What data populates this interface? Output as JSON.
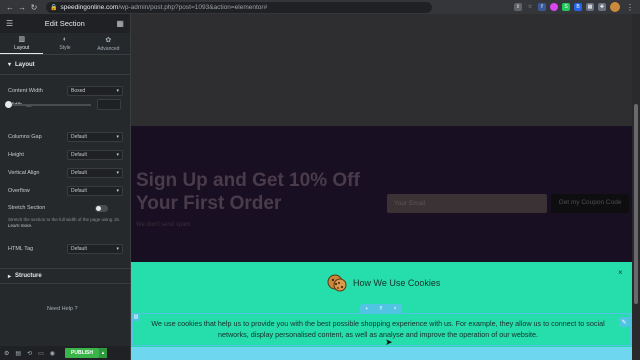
{
  "browser": {
    "nav": [
      "←",
      "→",
      "↻"
    ],
    "url_host": "speedingonline.com",
    "url_path": "/wp-admin/post.php?post=1093&action=elementor#",
    "extensions": [
      {
        "icon": "share-icon",
        "color": "#5f6368"
      },
      {
        "icon": "star-icon",
        "color": "#5f6368"
      },
      {
        "icon": "ext-f",
        "label": "f",
        "color": "#3b5998"
      },
      {
        "icon": "ext-colorwheel",
        "color": "#d946ef"
      },
      {
        "icon": "ext-s",
        "label": "S",
        "color": "#22c55e"
      },
      {
        "icon": "ext-b",
        "label": "B",
        "color": "#2563eb"
      },
      {
        "icon": "ext-grid",
        "color": "#6b7280"
      },
      {
        "icon": "ext-puzzle",
        "color": "#6b7280"
      }
    ]
  },
  "panel": {
    "title": "Edit Section",
    "tabs": [
      {
        "label": "Layout",
        "icon": "layout-icon",
        "glyph": "▥"
      },
      {
        "label": "Style",
        "icon": "style-icon",
        "glyph": "◐"
      },
      {
        "label": "Advanced",
        "icon": "gear-icon",
        "glyph": "✿"
      }
    ],
    "layout_section": "Layout",
    "content_width_label": "Content Width",
    "content_width_value": "Boxed",
    "width_label": "Width",
    "columns_gap_label": "Columns Gap",
    "columns_gap_value": "Default",
    "height_label": "Height",
    "height_value": "Default",
    "vertical_align_label": "Vertical Align",
    "vertical_align_value": "Default",
    "overflow_label": "Overflow",
    "overflow_value": "Default",
    "stretch_label": "Stretch Section",
    "stretch_help": "Stretch the section to the full width of the page using JS.",
    "learn_more": "Learn more.",
    "html_tag_label": "HTML Tag",
    "html_tag_value": "Default",
    "structure_section": "Structure",
    "need_help": "Need Help",
    "publish_label": "PUBLISH"
  },
  "preview": {
    "signup_title": "Sign Up and Get 10% Off Your First Order",
    "signup_subtitle": "We don't send spam",
    "email_placeholder": "Your Email",
    "coupon_button": "Get my Coupon Code",
    "cookie_title": "How We Use Cookies",
    "cookie_text": "We use cookies that help us to provide you with the best possible shopping experience with us. For example, they allow us to connect to social networks, display personalised content, as well as analyse and improve the operation of our website.",
    "close_glyph": "×"
  },
  "colors": {
    "panel_bg": "#26292c",
    "publish_green": "#39b54a",
    "cookie_bg": "#26ddac",
    "elementor_blue": "#52c4e3",
    "signup_bg": "#190f22"
  }
}
